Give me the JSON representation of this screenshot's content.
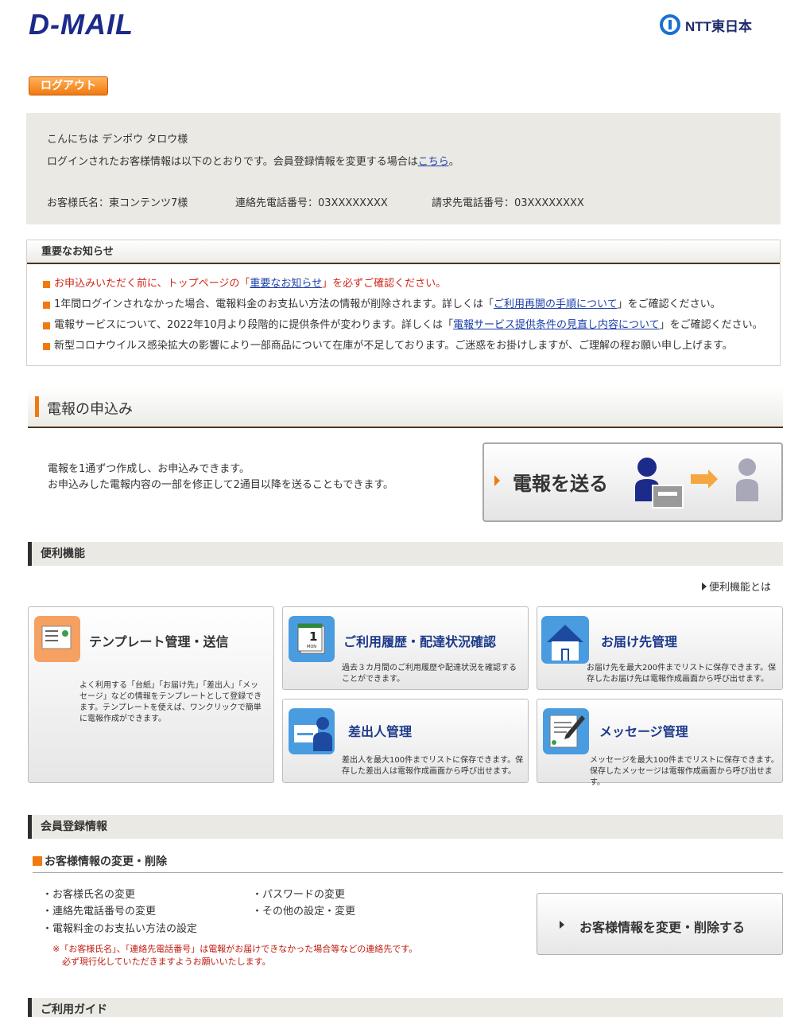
{
  "header": {
    "logo": "D-MAIL",
    "company": "NTT東日本"
  },
  "logout_label": "ログアウト",
  "greeting": {
    "hello": "こんにちは デンポウ タロウ様",
    "info_prefix": "ログインされたお客様情報は以下のとおりです。会員登録情報を変更する場合は",
    "info_link": "こちら",
    "info_suffix": "。",
    "name": "お客様氏名：東コンテンツ7様",
    "contact_phone": "連絡先電話番号：03XXXXXXXX",
    "billing_phone": "請求先電話番号：03XXXXXXXX"
  },
  "notice": {
    "title": "重要なお知らせ",
    "item1_prefix": "お申込みいただく前に、トップページの「",
    "item1_link": "重要なお知らせ",
    "item1_suffix": "」を必ずご確認ください。",
    "item2_prefix": "1年間ログインされなかった場合、電報料金のお支払い方法の情報が削除されます。詳しくは「",
    "item2_link": "ご利用再開の手順について",
    "item2_suffix": "」をご確認ください。",
    "item3_prefix": "電報サービスについて、2022年10月より段階的に提供条件が変わります。詳しくは「",
    "item3_link": "電報サービス提供条件の見直し内容について",
    "item3_suffix": "」をご確認ください。",
    "item4": "新型コロナウイルス感染拡大の影響により一部商品について在庫が不足しております。ご迷惑をお掛けしますが、ご理解の程お願い申し上げます。"
  },
  "apply": {
    "title": "電報の申込み",
    "desc1": "電報を1通ずつ作成し、お申込みできます。",
    "desc2": "お申込みした電報内容の一部を修正して2通目以降を送ることもできます。",
    "send_label": "電報を送る"
  },
  "features": {
    "title": "便利機能",
    "about_link": "便利機能とは",
    "template": {
      "title": "テンプレート管理・送信",
      "desc": "よく利用する「台紙」「お届け先」「差出人」「メッセージ」などの情報をテンプレートとして登録できます。テンプレートを使えば、ワンクリックで簡単に電報作成ができます。"
    },
    "history": {
      "title": "ご利用履歴・配達状況確認",
      "desc": "過去３カ月間のご利用履歴や配達状況を確認することができます。",
      "cal_day": "1",
      "cal_label": "MON"
    },
    "recipient": {
      "title": "お届け先管理",
      "desc": "お届け先を最大200件までリストに保存できます。保存したお届け先は電報作成画面から呼び出せます。"
    },
    "sender": {
      "title": "差出人管理",
      "desc": "差出人を最大100件までリストに保存できます。保存した差出人は電報作成画面から呼び出せます。"
    },
    "message": {
      "title": "メッセージ管理",
      "desc": "メッセージを最大100件までリストに保存できます。保存したメッセージは電報作成画面から呼び出せます。"
    }
  },
  "member": {
    "title": "会員登録情報",
    "subtitle": "お客様情報の変更・削除",
    "opt_name": "・お客様氏名の変更",
    "opt_phone": "・連絡先電話番号の変更",
    "opt_payment": "・電報料金のお支払い方法の設定",
    "opt_password": "・パスワードの変更",
    "opt_other": "・その他の設定・変更",
    "note1": "※「お客様氏名」、「連絡先電話番号」は電報がお届けできなかった場合等などの連絡先です。",
    "note2": "必ず現行化していただきますようお願いいたします。",
    "edit_label": "お客様情報を変更・削除する"
  },
  "guide": {
    "title": "ご利用ガイド"
  },
  "colors": {
    "brand_blue": "#1c2a8a",
    "accent_orange": "#f07a10",
    "link_blue": "#1a3fa8",
    "alert_red": "#d0281a"
  }
}
